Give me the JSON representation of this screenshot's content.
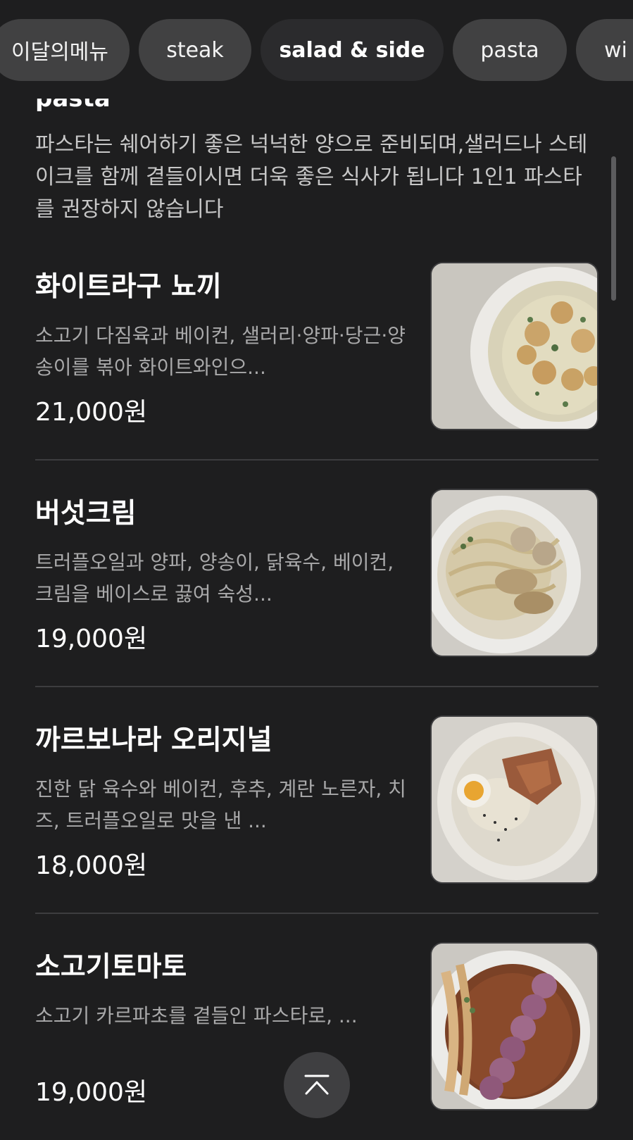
{
  "categories": [
    {
      "label": "이달의메뉴",
      "active": false
    },
    {
      "label": "steak",
      "active": false
    },
    {
      "label": "salad & side",
      "active": true
    },
    {
      "label": "pasta",
      "active": false
    },
    {
      "label": "wi",
      "active": false
    }
  ],
  "section": {
    "title": "pasta",
    "description": "파스타는 쉐어하기 좋은 넉넉한 양으로 준비되며,샐러드나 스테이크를 함께 곁들이시면 더욱 좋은 식사가 됩니다 1인1 파스타를 권장하지 않습니다"
  },
  "menu_items": [
    {
      "name": "화이트라구 뇨끼",
      "description": "소고기 다짐육과 베이컨, 샐러리·양파·당근·양송이를  볶아 화이트와인으...",
      "price": "21,000원",
      "photo_icon": "gnocchi-dish-photo"
    },
    {
      "name": "버섯크림",
      "description": "트러플오일과 양파, 양송이, 닭육수, 베이컨, 크림을 베이스로 끓여 숙성...",
      "price": "19,000원",
      "photo_icon": "mushroom-cream-pasta-photo"
    },
    {
      "name": "까르보나라 오리지널",
      "description": "진한 닭 육수와 베이컨, 후추, 계란 노른자, 치즈, 트러플오일로 맛을 낸 ...",
      "price": "18,000원",
      "photo_icon": "carbonara-dish-photo"
    },
    {
      "name": "소고기토마토",
      "description": "소고기 카르파초를 곁들인 파스타로, ...",
      "price": "19,000원",
      "photo_icon": "beef-tomato-pasta-photo"
    }
  ],
  "colors": {
    "background": "#1e1e1f",
    "chip": "#414142",
    "chip_active": "#2b2b2d",
    "description_text": "#a9a9aa",
    "divider": "#3d3d3f"
  },
  "icons": {
    "scroll_top": "chevron-up-icon"
  }
}
